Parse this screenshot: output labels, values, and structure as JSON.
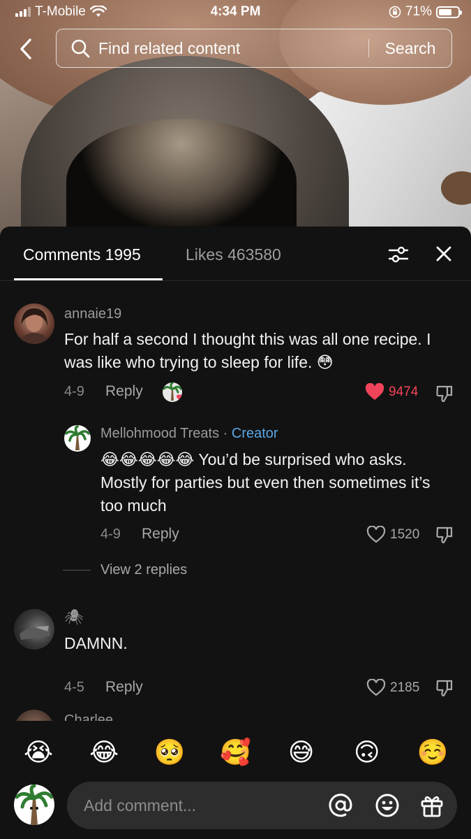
{
  "status_bar": {
    "carrier": "T-Mobile",
    "time": "4:34 PM",
    "battery": "71%",
    "battery_level": 0.71
  },
  "search": {
    "query": "Find related content",
    "button_label": "Search"
  },
  "tabs": {
    "comments": "Comments 1995",
    "likes": "Likes 463580"
  },
  "comments": [
    {
      "username": "annaie19",
      "text": "For half a second I thought this was all one recipe. I was like who trying to sleep for life. 😳",
      "date": "4-9",
      "reply_label": "Reply",
      "likes": "9474",
      "liked": true
    },
    {
      "username": "Mellohmood Treats",
      "creator_label": "Creator",
      "separator": "·",
      "text": "😂😂😂😂😂 You’d be surprised who asks. Mostly for parties but even then sometimes it’s too much",
      "date": "4-9",
      "reply_label": "Reply",
      "likes": "1520",
      "liked": false
    },
    {
      "username": "🕷",
      "text": "DAMNN.",
      "date": "4-5",
      "reply_label": "Reply",
      "likes": "2185",
      "liked": false
    },
    {
      "username": "Charlee"
    }
  ],
  "view_replies": "View 2 replies",
  "emoji_bar": [
    "😭",
    "😂",
    "🥺",
    "🥰",
    "😅",
    "🙃",
    "☺️"
  ],
  "composer": {
    "placeholder": "Add comment..."
  },
  "colors": {
    "panel_bg": "#121212",
    "like_red": "#f0445a",
    "creator_blue": "#5aa6e6",
    "input_bg": "#2d2d2d"
  }
}
